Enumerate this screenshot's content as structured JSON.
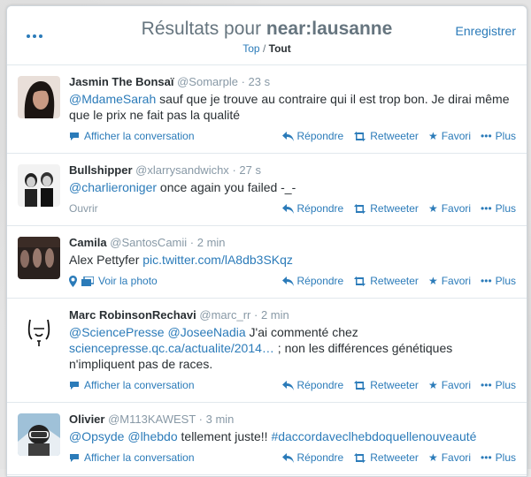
{
  "header": {
    "title_prefix": "Résultats pour ",
    "query": "near:lausanne",
    "save_label": "Enregistrer",
    "top_label": "Top",
    "separator": " / ",
    "all_label": "Tout"
  },
  "actions": {
    "reply": "Répondre",
    "retweet": "Retweeter",
    "favorite": "Favori",
    "more": "Plus"
  },
  "tweets": [
    {
      "name": "Jasmin The Bonsaï",
      "handle": "@Somarple",
      "time": "· 23 s",
      "mention": "@MdameSarah",
      "text": " sauf que je trouve au contraire qui il est trop bon. Je dirai même que le prix ne fait pas la qualité",
      "footer_left": "Afficher la conversation"
    },
    {
      "name": "Bullshipper",
      "handle": "@xlarrysandwichx",
      "time": "· 27 s",
      "mention": "@charlieroniger",
      "text": " once again you failed -_-",
      "footer_left": "Ouvrir"
    },
    {
      "name": "Camila",
      "handle": "@SantosCamii",
      "time": "· 2 min",
      "text": "Alex Pettyfer ",
      "link": "pic.twitter.com/lA8db3SKqz",
      "footer_left": "Voir la photo"
    },
    {
      "name": "Marc RobinsonRechavi",
      "handle": "@marc_rr",
      "time": "· 2 min",
      "mention": "@SciencePresse",
      "mention2": "@JoseeNadia",
      "text": " J'ai commenté chez",
      "link": "sciencepresse.qc.ca/actualite/2014…",
      "text2": " ; non les différences génétiques n'impliquent pas de races.",
      "footer_left": "Afficher la conversation"
    },
    {
      "name": "Olivier",
      "handle": "@M113KAWEST",
      "time": "· 3 min",
      "mention": "@Opsyde",
      "mention2": "@lhebdo",
      "text": " tellement juste!! ",
      "hashtag": "#daccordaveclhebdoquellenouveauté",
      "footer_left": "Afficher la conversation"
    }
  ],
  "colors": {
    "link": "#2b7bb9",
    "muted": "#8899a6",
    "text": "#292f33"
  }
}
